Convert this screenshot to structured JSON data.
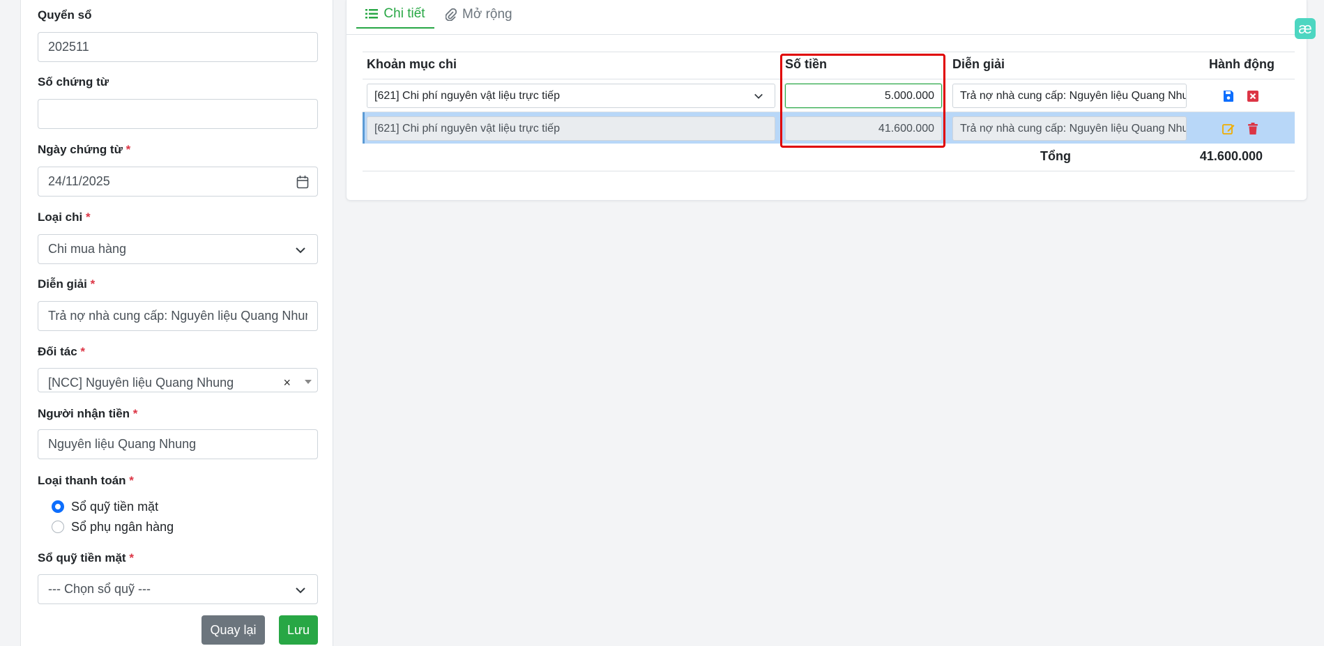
{
  "form": {
    "quyen_so": {
      "label": "Quyển sổ",
      "value": "202511"
    },
    "so_chung_tu": {
      "label": "Số chứng từ",
      "value": ""
    },
    "ngay_chung_tu": {
      "label": "Ngày chứng từ",
      "required": "*",
      "value": "24/11/2025"
    },
    "loai_chi": {
      "label": "Loại chi",
      "required": "*",
      "value": "Chi mua hàng"
    },
    "dien_giai": {
      "label": "Diễn giải",
      "required": "*",
      "value": "Trả nợ nhà cung cấp: Nguyên liệu Quang Nhung"
    },
    "doi_tac": {
      "label": "Đối tác",
      "required": "*",
      "value": "[NCC] Nguyên liệu Quang Nhung",
      "clear": "×"
    },
    "nguoi_nhan_tien": {
      "label": "Người nhận tiền",
      "required": "*",
      "value": "Nguyên liệu Quang Nhung"
    },
    "loai_thanh_toan": {
      "label": "Loại thanh toán",
      "required": "*",
      "options": [
        {
          "label": "Sổ quỹ tiền mặt",
          "checked": true
        },
        {
          "label": "Sổ phụ ngân hàng",
          "checked": false
        }
      ]
    },
    "so_quy_tien_mat": {
      "label": "Sổ quỹ tiền mặt",
      "required": "*",
      "value": "--- Chọn sổ quỹ ---"
    },
    "buttons": {
      "back": "Quay lại",
      "save": "Lưu"
    }
  },
  "tabs": [
    {
      "label": "Chi tiết",
      "active": true
    },
    {
      "label": "Mở rộng",
      "active": false
    }
  ],
  "table": {
    "headers": [
      "Khoản mục chi",
      "Số tiền",
      "Diễn giải",
      "Hành động"
    ],
    "rows": [
      {
        "khoan_muc": "[621] Chi phí nguyên vật liệu trực tiếp",
        "so_tien": "5.000.000",
        "dien_giai": "Trả nợ nhà cung cấp: Nguyên liệu Quang Nhung",
        "editing": true
      },
      {
        "khoan_muc": "[621] Chi phí nguyên vật liệu trực tiếp",
        "so_tien": "41.600.000",
        "dien_giai": "Trả nợ nhà cung cấp: Nguyên liệu Quang Nhung",
        "editing": false
      }
    ],
    "total_label": "Tổng",
    "total_value": "41.600.000"
  },
  "badge": "æ",
  "colors": {
    "accent": "#28a745",
    "danger": "#dc3545",
    "primary": "#0d6efd",
    "warning": "#f0ad00",
    "highlight": "#e00000"
  }
}
